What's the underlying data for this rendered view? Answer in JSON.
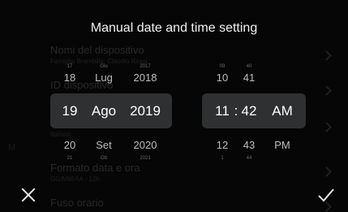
{
  "dialog": {
    "title": "Manual date and time setting",
    "cancel_icon": "close-icon",
    "confirm_icon": "check-icon"
  },
  "background_list": {
    "items": [
      {
        "label": "Nomi del dispositivo",
        "sub": "Famiglia Brambilla; Claudio Rossi"
      },
      {
        "label": "ID dispositivo",
        "sub": ""
      },
      {
        "label": "",
        "sub": "Italiano"
      },
      {
        "label": "Formato data e ora",
        "sub": "GG/MM/AA - 12h"
      },
      {
        "label": "Fuso orario",
        "sub": ""
      }
    ],
    "side_label": "M"
  },
  "date_picker": {
    "day": {
      "above_far": "17",
      "above": "18",
      "selected": "19",
      "below": "20",
      "below_far": "21"
    },
    "month": {
      "above_far": "Giu",
      "above": "Lug",
      "selected": "Ago",
      "below": "Set",
      "below_far": "Ott"
    },
    "year": {
      "above_far": "2017",
      "above": "2018",
      "selected": "2019",
      "below": "2020",
      "below_far": "2021"
    }
  },
  "time_picker": {
    "hour": {
      "above_far": "09",
      "above": "10",
      "selected": "11",
      "below": "12",
      "below_far": "1"
    },
    "separator": ":",
    "minute": {
      "above_far": "40",
      "above": "41",
      "selected": "42",
      "below": "43",
      "below_far": "44"
    },
    "ampm": {
      "selected": "AM",
      "below": "PM"
    }
  }
}
